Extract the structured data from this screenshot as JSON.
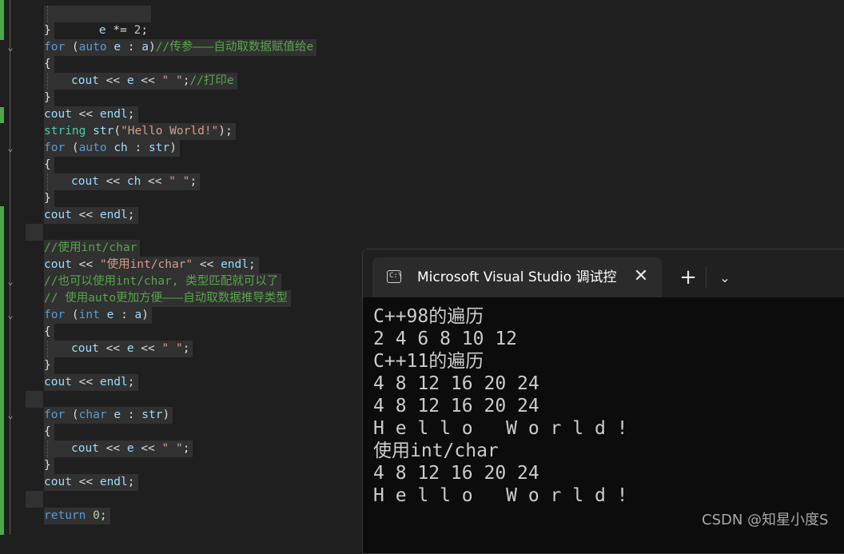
{
  "editor": {
    "lines": [
      "e *= 2;",
      "}",
      "for (auto e : a)//传参———自动取数据赋值给e",
      "{",
      "cout << e << \" \";//打印e",
      "}",
      "cout << endl;",
      "string str(\"Hello World!\");",
      "for (auto ch : str)",
      "{",
      "cout << ch << \" \";",
      "}",
      "cout << endl;",
      "",
      "//使用int/char",
      "cout << \"使用int/char\" << endl;",
      "//也可以使用int/char, 类型匹配就可以了",
      "// 使用auto更加方便———自动取数据推导类型",
      "for (int e : a)",
      "{",
      "cout << e << \" \";",
      "}",
      "cout << endl;",
      "",
      "for (char e : str)",
      "{",
      "cout << e << \" \";",
      "}",
      "cout << endl;",
      "",
      "return 0;"
    ]
  },
  "terminal": {
    "tab_title": "Microsoft Visual Studio 调试控制台",
    "tab_icon": "terminal-icon",
    "close_glyph": "✕",
    "new_tab_glyph": "+",
    "dropdown_glyph": "⌄",
    "output": [
      "C++98的遍历",
      "2 4 6 8 10 12",
      "C++11的遍历",
      "4 8 12 16 20 24",
      "4 8 12 16 20 24",
      "H e l l o   W o r l d !",
      "使用int/char",
      "4 8 12 16 20 24",
      "H e l l o   W o r l d !"
    ]
  },
  "watermark": "CSDN @知星小度S"
}
